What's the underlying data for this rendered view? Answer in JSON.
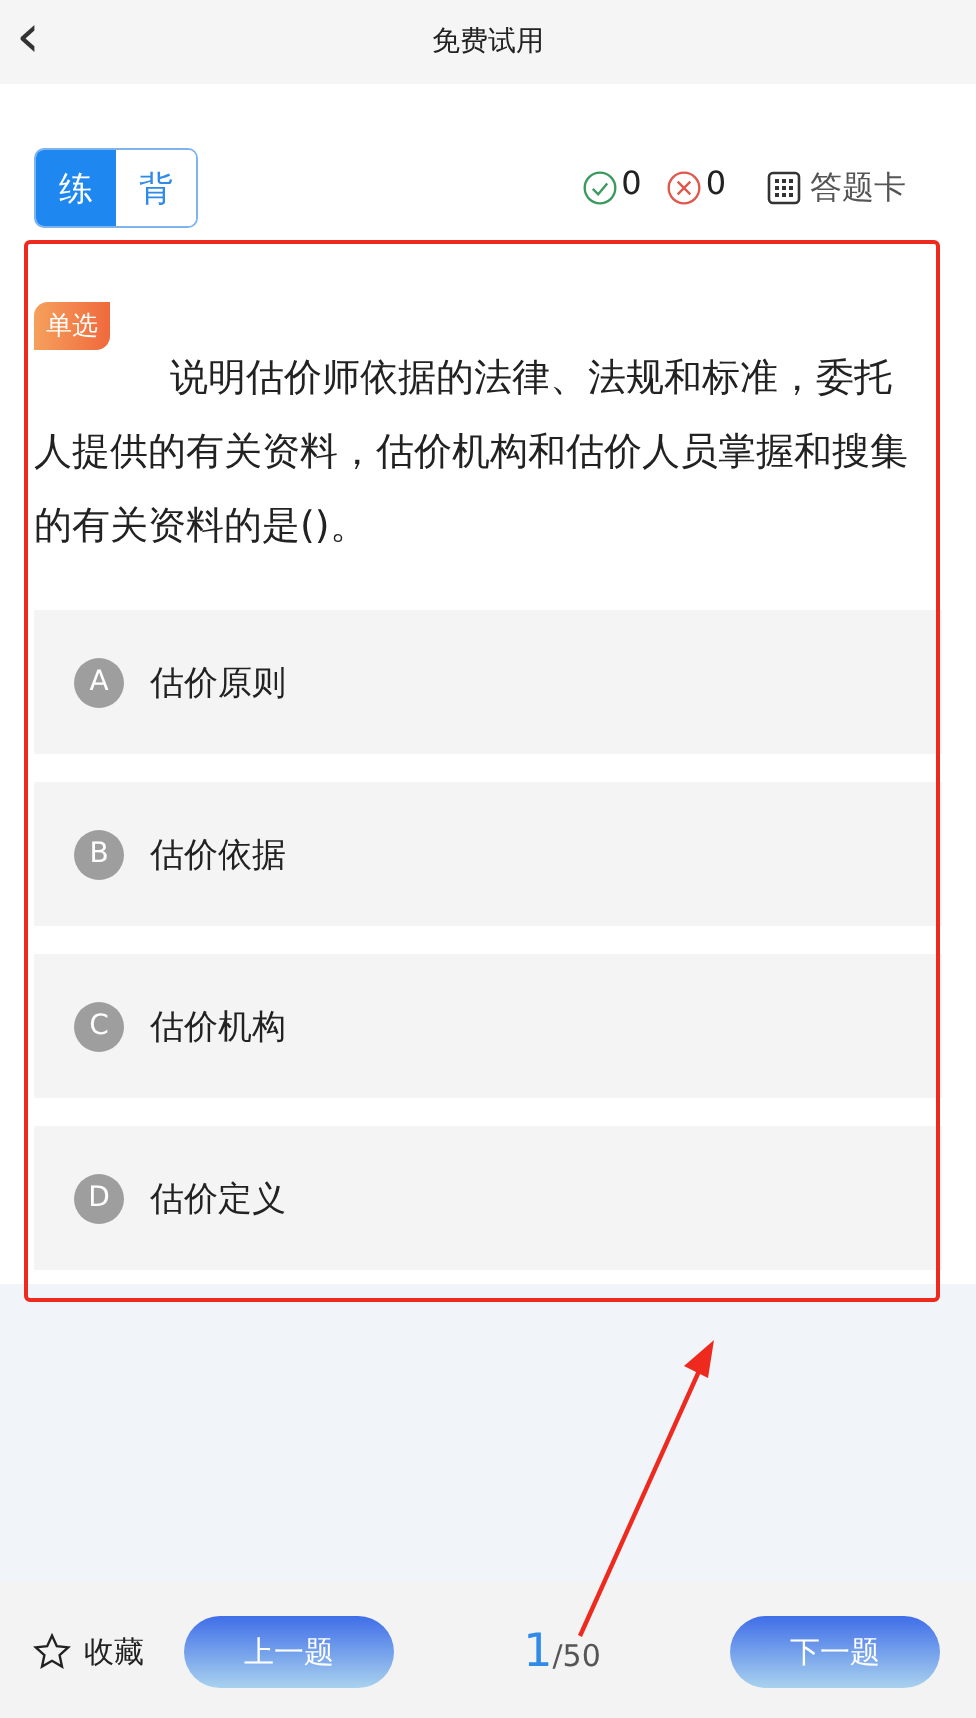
{
  "header": {
    "back_icon": "‹",
    "title": "免费试用"
  },
  "modes": [
    {
      "label": "练",
      "selected": true
    },
    {
      "label": "背",
      "selected": false
    }
  ],
  "stats": {
    "correct": "0",
    "wrong": "0",
    "answer_card": "答题卡"
  },
  "question": {
    "type_tag": "单选",
    "text": "说明估价师依据的法律、法规和标准，委托人提供的有关资料，估价机构和估价人员掌握和搜集的有关资料的是()。"
  },
  "options": [
    {
      "letter": "A",
      "text": "估价原则"
    },
    {
      "letter": "B",
      "text": "估价依据"
    },
    {
      "letter": "C",
      "text": "估价机构"
    },
    {
      "letter": "D",
      "text": "估价定义"
    }
  ],
  "footer": {
    "favorite": "收藏",
    "prev": "上一题",
    "current": "1",
    "total": "/50",
    "next": "下一题"
  }
}
